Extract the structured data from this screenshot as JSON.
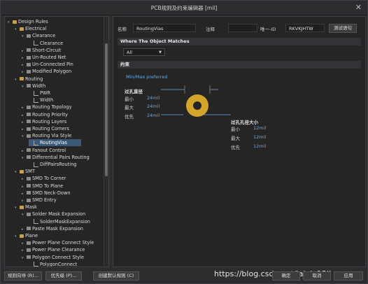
{
  "window": {
    "title": "PCB规则及约束编辑器 [mil]",
    "close": "✕"
  },
  "tree": [
    {
      "label": "Design Rules",
      "arrow": "▾",
      "icon": "folder",
      "level": 0
    },
    {
      "label": "Electrical",
      "arrow": "▾",
      "icon": "folder",
      "level": 1
    },
    {
      "label": "Clearance",
      "arrow": "▾",
      "icon": "rule",
      "level": 2
    },
    {
      "label": "Clearance",
      "arrow": "",
      "icon": "leaf",
      "level": 3
    },
    {
      "label": "Short-Circuit",
      "arrow": "▸",
      "icon": "rule",
      "level": 2
    },
    {
      "label": "Un-Routed Net",
      "arrow": "▸",
      "icon": "rule",
      "level": 2
    },
    {
      "label": "Un-Connected Pin",
      "arrow": "▸",
      "icon": "rule",
      "level": 2
    },
    {
      "label": "Modified Polygon",
      "arrow": "▸",
      "icon": "rule",
      "level": 2
    },
    {
      "label": "Routing",
      "arrow": "▾",
      "icon": "folder",
      "level": 1
    },
    {
      "label": "Width",
      "arrow": "▾",
      "icon": "rule",
      "level": 2
    },
    {
      "label": "PWR",
      "arrow": "",
      "icon": "leaf",
      "level": 3
    },
    {
      "label": "Width",
      "arrow": "",
      "icon": "leaf",
      "level": 3
    },
    {
      "label": "Routing Topology",
      "arrow": "▸",
      "icon": "rule",
      "level": 2
    },
    {
      "label": "Routing Priority",
      "arrow": "▸",
      "icon": "rule",
      "level": 2
    },
    {
      "label": "Routing Layers",
      "arrow": "▸",
      "icon": "rule",
      "level": 2
    },
    {
      "label": "Routing Corners",
      "arrow": "▸",
      "icon": "rule",
      "level": 2
    },
    {
      "label": "Routing Via Style",
      "arrow": "▾",
      "icon": "rule",
      "level": 2
    },
    {
      "label": "RoutingVias",
      "arrow": "",
      "icon": "leaf",
      "level": 3,
      "selected": true
    },
    {
      "label": "Fanout Control",
      "arrow": "▸",
      "icon": "rule",
      "level": 2
    },
    {
      "label": "Differential Pairs Routing",
      "arrow": "▾",
      "icon": "rule",
      "level": 2
    },
    {
      "label": "DiffPairsRouting",
      "arrow": "",
      "icon": "leaf",
      "level": 3
    },
    {
      "label": "SMT",
      "arrow": "▾",
      "icon": "folder",
      "level": 1
    },
    {
      "label": "SMD To Corner",
      "arrow": "▸",
      "icon": "rule",
      "level": 2
    },
    {
      "label": "SMD To Plane",
      "arrow": "▸",
      "icon": "rule",
      "level": 2
    },
    {
      "label": "SMD Neck-Down",
      "arrow": "▸",
      "icon": "rule",
      "level": 2
    },
    {
      "label": "SMD Entry",
      "arrow": "▸",
      "icon": "rule",
      "level": 2
    },
    {
      "label": "Mask",
      "arrow": "▾",
      "icon": "folder",
      "level": 1
    },
    {
      "label": "Solder Mask Expansion",
      "arrow": "▾",
      "icon": "rule",
      "level": 2
    },
    {
      "label": "SolderMaskExpansion",
      "arrow": "",
      "icon": "leaf",
      "level": 3
    },
    {
      "label": "Paste Mask Expansion",
      "arrow": "▸",
      "icon": "rule",
      "level": 2
    },
    {
      "label": "Plane",
      "arrow": "▾",
      "icon": "folder",
      "level": 1
    },
    {
      "label": "Power Plane Connect Style",
      "arrow": "▸",
      "icon": "rule",
      "level": 2
    },
    {
      "label": "Power Plane Clearance",
      "arrow": "▸",
      "icon": "rule",
      "level": 2
    },
    {
      "label": "Polygon Connect Style",
      "arrow": "▾",
      "icon": "rule",
      "level": 2
    },
    {
      "label": "PolygonConnect",
      "arrow": "",
      "icon": "leaf",
      "level": 3
    }
  ],
  "rule": {
    "name_label": "名称",
    "name_value": "RoutingVias",
    "comment_label": "注释",
    "comment_value": "",
    "uid_label": "唯一-ID",
    "uid_value": "RKVKJHTW",
    "test_button": "测试语句"
  },
  "where": {
    "header": "Where The Object Matches",
    "scope": "All"
  },
  "constraints": {
    "header": "约束",
    "mode": "Min/Max preferred",
    "via_diameter": {
      "title": "过孔直径",
      "min_label": "最小",
      "min": "24mil",
      "max_label": "最大",
      "max": "24mil",
      "pref_label": "优先",
      "pref": "24mil"
    },
    "hole_size": {
      "title": "过孔孔径大小",
      "min_label": "最小",
      "min": "12mil",
      "max_label": "最大",
      "max": "12mil",
      "pref_label": "优先",
      "pref": "12mil"
    }
  },
  "footer": {
    "wizard": "规则向导 (R)...",
    "priority": "优先级 (P)...",
    "create_default": "创建默认规则 (C)",
    "ok": "确定",
    "cancel": "取消",
    "apply": "应用",
    "watermark": "https://blog.csdn.net/lalala12ll"
  },
  "colors": {
    "via_ring": "#d4a52a",
    "via_hole": "#252526",
    "selection": "#3b5a7a",
    "accent_text": "#6ea8dc"
  }
}
